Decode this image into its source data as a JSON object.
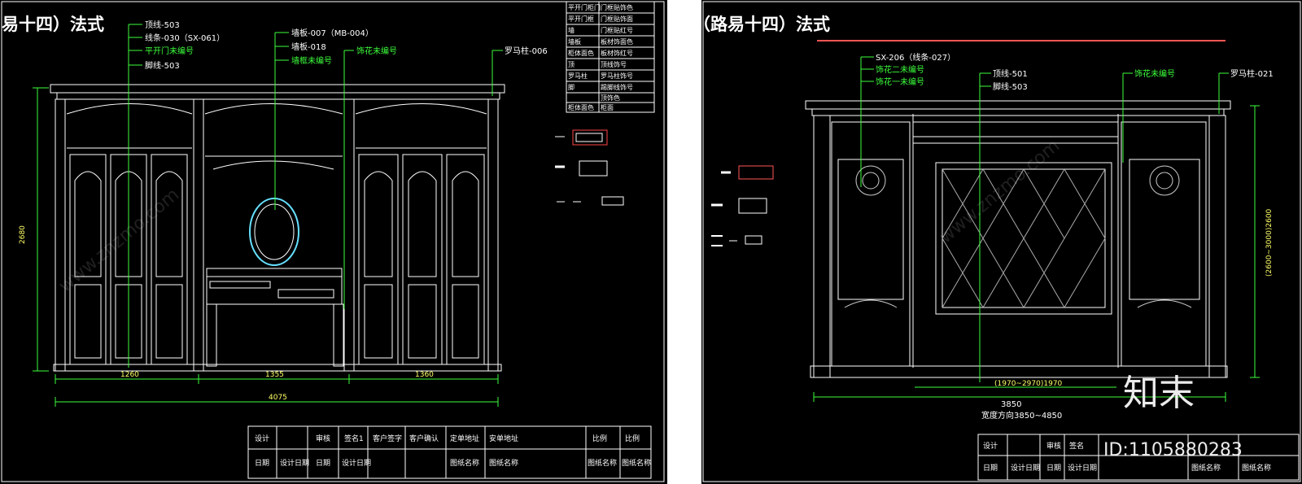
{
  "left": {
    "title": "易十四）法式",
    "labels_white": [
      "顶线-503",
      "线条-030（SX-061）",
      "脚线-503",
      "墙板-007（MB-004）",
      "墙板-018",
      "罗马柱-006"
    ],
    "labels_green": [
      "平开门未编号",
      "墙框未编号",
      "饰花未编号"
    ],
    "dim_height": "2680",
    "dims_bottom": [
      "1260",
      "1355",
      "1360"
    ],
    "dim_total": "4075",
    "legend_rows": [
      [
        "平开门柜门",
        "门框贴饰色"
      ],
      [
        "平开门框",
        "门框贴饰面"
      ],
      [
        "墙",
        "门框贴红号"
      ],
      [
        "墙板",
        "板材饰面色"
      ],
      [
        "柜体面色",
        "板材饰红号"
      ],
      [
        "顶",
        "顶线饰号"
      ],
      [
        "罗马柱",
        "罗马柱饰号"
      ],
      [
        "脚",
        "踢脚线饰号"
      ],
      [
        "",
        "顶饰色"
      ],
      [
        "柜体面色",
        "柜面"
      ]
    ],
    "title_block": {
      "row1": [
        "设计",
        "审核",
        "签名1",
        "客户签字",
        "客户确认",
        "定单地址",
        "安单地址",
        "比例",
        "比例"
      ],
      "row2": [
        "日期",
        "设计日期",
        "日期",
        "设计日期",
        "图纸名称",
        "图纸名称",
        "图纸名称",
        "图纸名称"
      ]
    }
  },
  "right": {
    "title": "（路易十四）法式",
    "labels_white": [
      "SX-206（线条-027）",
      "顶线-501",
      "脚线-503",
      "罗马柱-021"
    ],
    "labels_green": [
      "饰花二未编号",
      "饰花一未编号",
      "饰花未编号"
    ],
    "dim_height": "(2600~3000)2600",
    "dim_mid": "(1970~2970)1970",
    "dim_total": "3850",
    "dim_caption": "宽度方向3850~4850",
    "title_block": {
      "row1": [
        "设计",
        "审核",
        "签名"
      ],
      "row2": [
        "日期",
        "设计日期",
        "日期",
        "设计日期",
        "图纸名称",
        "图纸名称"
      ]
    }
  },
  "watermark": {
    "logo_text": "知末",
    "id_text": "ID:1105880283",
    "faint_text": "www.znzmo.com"
  },
  "colors": {
    "background": "#000000",
    "lines": "#ffffff",
    "annotation_green": "#3dff3d",
    "dimension_green": "#3dff3d",
    "cyan": "#66e0ff",
    "gutter": "#ffffff"
  }
}
